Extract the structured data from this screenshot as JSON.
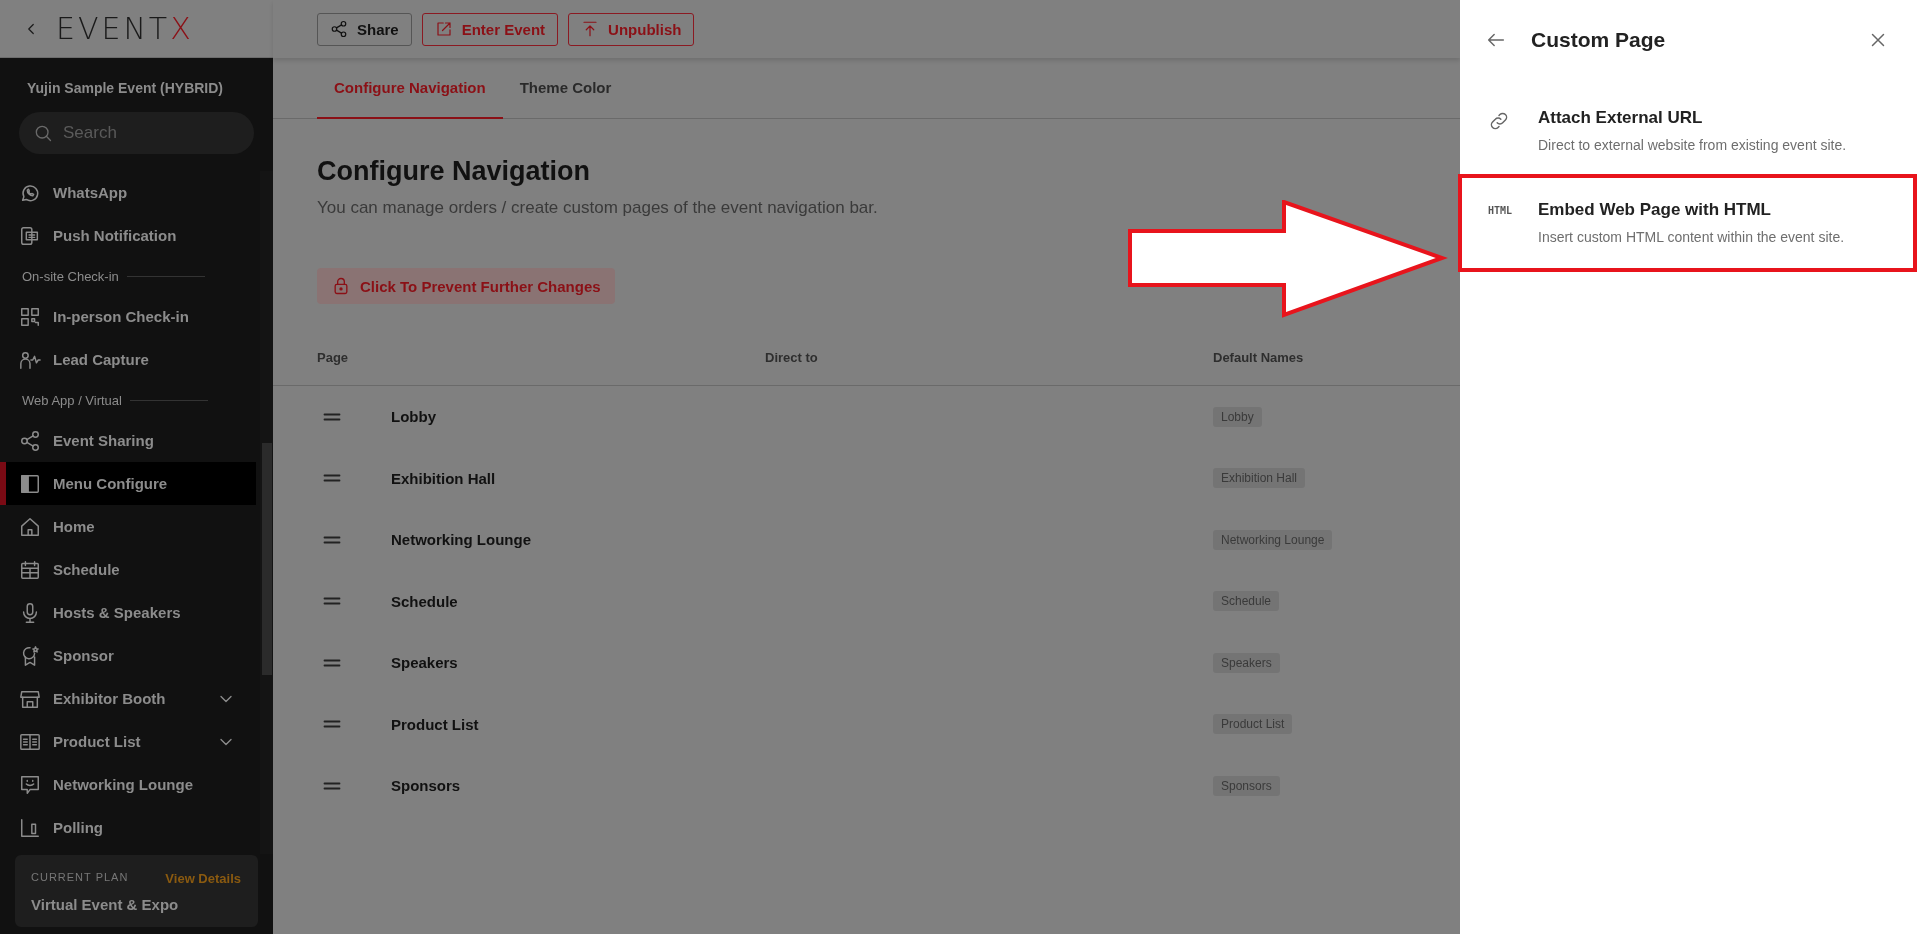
{
  "logo": {
    "main": "EVENT",
    "accent": "X"
  },
  "sidebar": {
    "event_title": "Yujin Sample Event (HYBRID)",
    "search": {
      "placeholder": "Search"
    },
    "items": [
      {
        "kind": "item",
        "label": "WhatsApp",
        "selected": false
      },
      {
        "kind": "item",
        "label": "Push Notification",
        "selected": false
      },
      {
        "kind": "section",
        "label": "On-site Check-in"
      },
      {
        "kind": "item",
        "label": "In-person Check-in",
        "selected": false
      },
      {
        "kind": "item",
        "label": "Lead Capture",
        "selected": false
      },
      {
        "kind": "section",
        "label": "Web App / Virtual"
      },
      {
        "kind": "item",
        "label": "Event Sharing",
        "selected": false
      },
      {
        "kind": "item",
        "label": "Menu Configure",
        "selected": true
      },
      {
        "kind": "item",
        "label": "Home",
        "selected": false
      },
      {
        "kind": "item",
        "label": "Schedule",
        "selected": false
      },
      {
        "kind": "item",
        "label": "Hosts & Speakers",
        "selected": false
      },
      {
        "kind": "item",
        "label": "Sponsor",
        "selected": false
      },
      {
        "kind": "group",
        "label": "Exhibitor Booth",
        "selected": false,
        "expanded": false
      },
      {
        "kind": "group",
        "label": "Product List",
        "selected": false,
        "expanded": false
      },
      {
        "kind": "item",
        "label": "Networking Lounge",
        "selected": false
      },
      {
        "kind": "item",
        "label": "Polling",
        "selected": false
      }
    ],
    "plan": {
      "label": "CURRENT PLAN",
      "link": "View Details",
      "name": "Virtual Event & Expo"
    }
  },
  "toolbar": [
    {
      "label": "Share",
      "kind": "neutral"
    },
    {
      "label": "Enter Event",
      "kind": "danger"
    },
    {
      "label": "Unpublish",
      "kind": "danger"
    }
  ],
  "tabs": [
    {
      "label": "Configure Navigation",
      "selected": true
    },
    {
      "label": "Theme Color",
      "selected": false
    }
  ],
  "content": {
    "title": "Configure Navigation",
    "subtitle": "You can manage orders / create custom pages of the event navigation bar.",
    "lock_button": "Click To Prevent Further Changes",
    "table": {
      "columns": [
        "Page",
        "Direct to",
        "Default Names"
      ],
      "rows": [
        {
          "page": "Lobby",
          "default_name": "Lobby"
        },
        {
          "page": "Exhibition Hall",
          "default_name": "Exhibition Hall"
        },
        {
          "page": "Networking Lounge",
          "default_name": "Networking Lounge"
        },
        {
          "page": "Schedule",
          "default_name": "Schedule"
        },
        {
          "page": "Speakers",
          "default_name": "Speakers"
        },
        {
          "page": "Product List",
          "default_name": "Product List"
        },
        {
          "page": "Sponsors",
          "default_name": "Sponsors"
        }
      ]
    }
  },
  "panel": {
    "title": "Custom Page",
    "options": [
      {
        "kind": "link",
        "title": "Attach External URL",
        "description": "Direct to external website from existing event site.",
        "highlighted": false
      },
      {
        "kind": "html",
        "icon_text": "HTML",
        "title": "Embed Web Page with HTML",
        "description": "Insert custom HTML content within the event site.",
        "highlighted": true
      }
    ]
  }
}
